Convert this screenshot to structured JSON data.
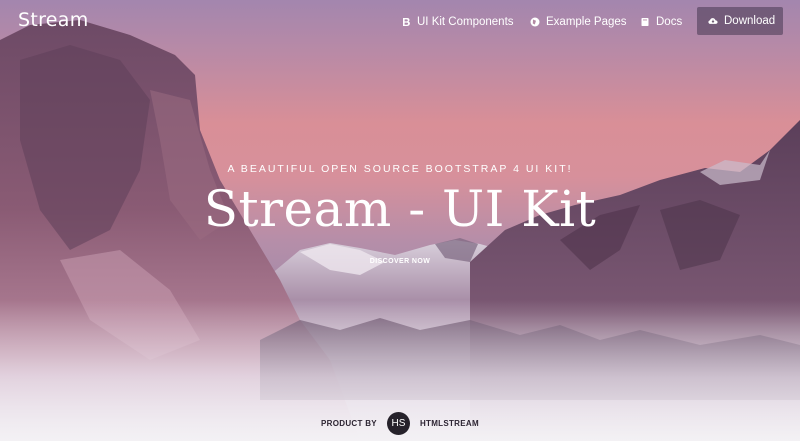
{
  "navbar": {
    "brand": "Stream",
    "links": [
      {
        "label": "UI Kit Components",
        "icon": "bootstrap-icon"
      },
      {
        "label": "Example Pages",
        "icon": "pages-icon"
      },
      {
        "label": "Docs",
        "icon": "book-icon"
      },
      {
        "label": "Download",
        "icon": "cloud-download-icon"
      }
    ]
  },
  "hero": {
    "tagline": "A BEAUTIFUL OPEN SOURCE BOOTSTRAP 4 UI KIT!",
    "title": "Stream - UI Kit",
    "cta": "DISCOVER NOW"
  },
  "credit": {
    "label": "PRODUCT BY",
    "logo_text": "HS",
    "name": "HTMLSTREAM"
  },
  "colors": {
    "sky_top": "#a386ae",
    "sky_pink": "#d98f97",
    "rock_dark": "#5a3e58",
    "rock_mid": "#8a5f7a",
    "footer_fade": "#f2eef3",
    "text": "#ffffff"
  }
}
